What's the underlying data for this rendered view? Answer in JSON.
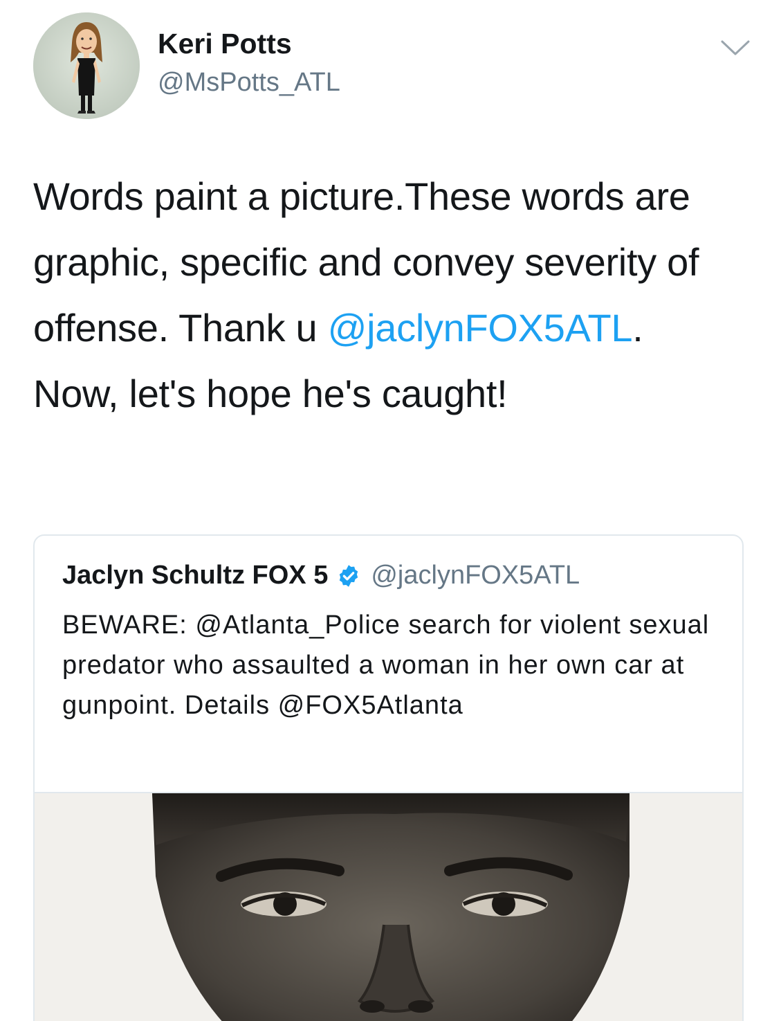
{
  "tweet": {
    "author": {
      "name": "Keri Potts",
      "handle": "@MsPotts_ATL",
      "avatar_icon": "bitmoji-avatar-icon"
    },
    "menu_icon": "chevron-down-icon",
    "text_parts": {
      "before_mention": "Words paint a picture.These words are graphic, specific and convey severity of offense. Thank u ",
      "mention": "@jaclynFOX5ATL",
      "after_mention": ". Now, let's hope he's caught!"
    },
    "colors": {
      "link": "#1da1f2",
      "secondary_text": "#657786",
      "border": "#e1e8ed"
    }
  },
  "quoted_tweet": {
    "author_name": "Jaclyn Schultz FOX 5",
    "verified_icon": "verified-badge-icon",
    "handle": "@jaclynFOX5ATL",
    "text": "BEWARE: @Atlanta_Police search for violent sexual predator who assaulted a woman in her own car at gunpoint. Details @FOX5Atlanta",
    "media": "suspect-sketch-image"
  }
}
